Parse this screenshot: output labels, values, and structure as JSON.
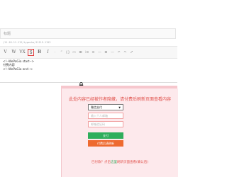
{
  "title_input": {
    "placeholder": "标题"
  },
  "url_line": "/11.18.11.112/typecho/11115-1152",
  "toolbar": {
    "buttons": [
      {
        "id": "blockquote",
        "label": "V"
      },
      {
        "id": "code",
        "label": "W"
      },
      {
        "id": "pay",
        "label": "VX"
      },
      {
        "id": "hide",
        "label": "S"
      },
      {
        "id": "bold",
        "label": "B"
      },
      {
        "id": "italic",
        "label": "I"
      }
    ],
    "small_icons": [
      "·",
      "“",
      "{}",
      "▭",
      "⊞",
      "⁝≡",
      "≡",
      "—",
      "⊟",
      "—",
      "↶",
      "↷",
      "⤢"
    ]
  },
  "editor": {
    "lines": [
      "<!--WePaGia start-->",
      "付费内容",
      "<!--WePaGia end-->"
    ]
  },
  "paywall": {
    "notice": "此处内容已经被作者隐藏，请付费后刷新页面查看内容",
    "select_value": "微信支付",
    "field1_placeholder": "输入个人邮箱",
    "field2_placeholder": "邮箱验证码",
    "pay_button": "支付",
    "paid_button": "付费后请刷新",
    "footer_prefix": "已付款？点击",
    "footer_link": "这里",
    "footer_suffix": "刷新页面查看(确认后)"
  },
  "colors": {
    "accent_red": "#e0514b",
    "pay_green": "#2fae5c",
    "paid_orange": "#ee6a2f",
    "paywall_bg": "#fde9ec"
  }
}
